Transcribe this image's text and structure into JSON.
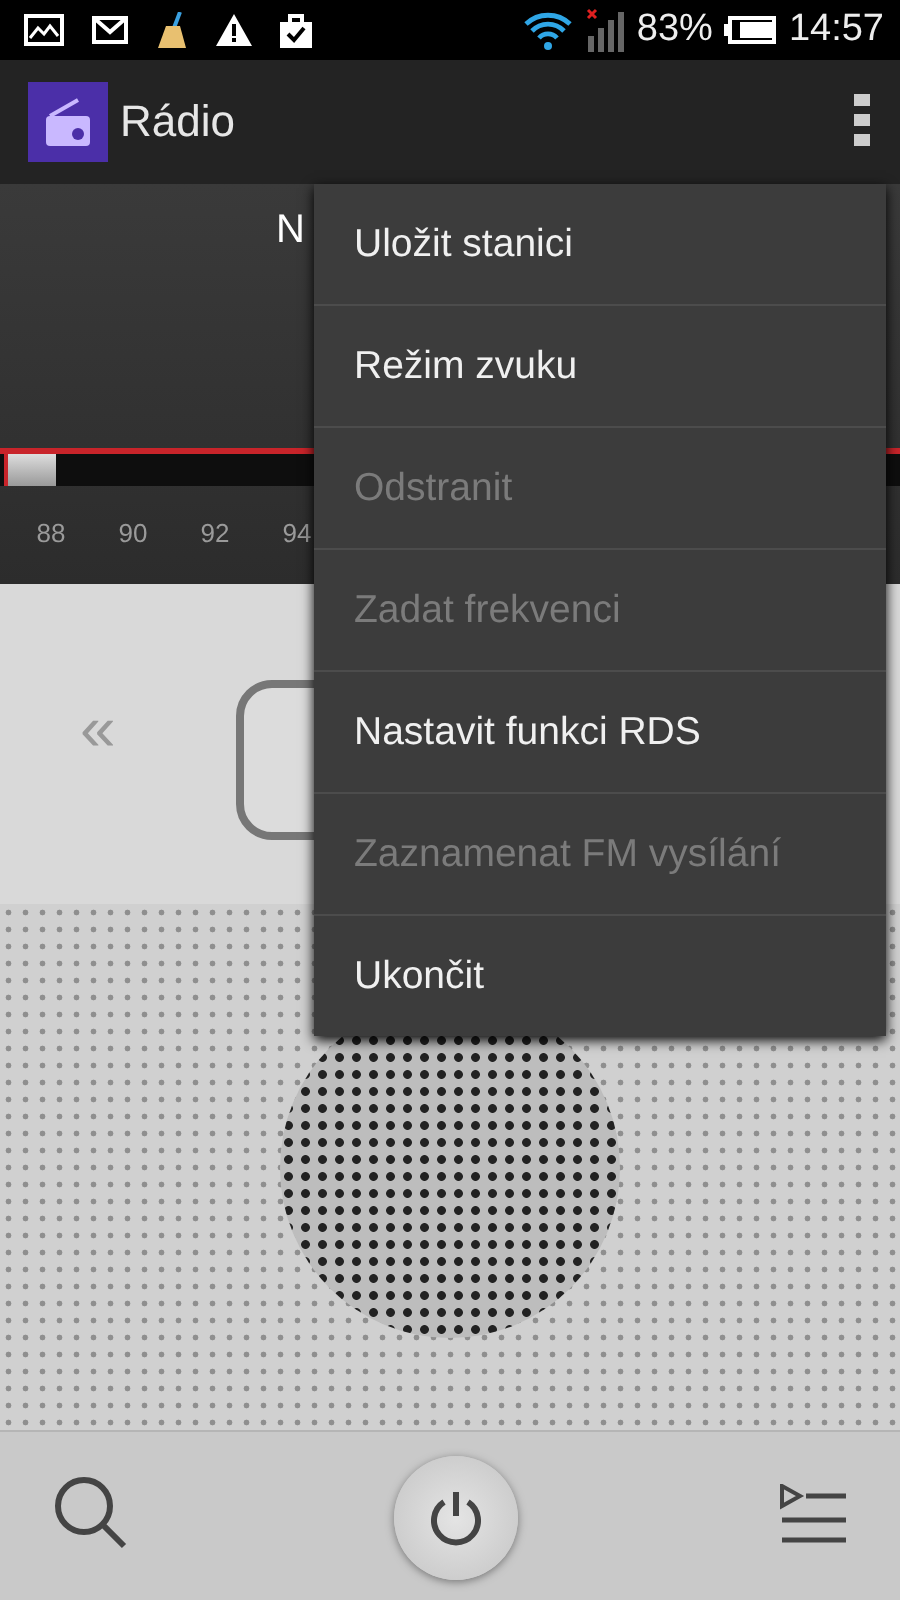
{
  "status_bar": {
    "battery": "83%",
    "time": "14:57"
  },
  "action_bar": {
    "title": "Rádio"
  },
  "tuner": {
    "station": "N",
    "scale_labels": [
      "88",
      "90",
      "92",
      "94"
    ]
  },
  "controls": {
    "previous": "«"
  },
  "menu": [
    {
      "label": "Uložit stanici",
      "disabled": false
    },
    {
      "label": "Režim zvuku",
      "disabled": false
    },
    {
      "label": "Odstranit",
      "disabled": true
    },
    {
      "label": "Zadat frekvenci",
      "disabled": true
    },
    {
      "label": "Nastavit funkci RDS",
      "disabled": false
    },
    {
      "label": "Zaznamenat FM vysílání",
      "disabled": true
    },
    {
      "label": "Ukončit",
      "disabled": false
    }
  ]
}
